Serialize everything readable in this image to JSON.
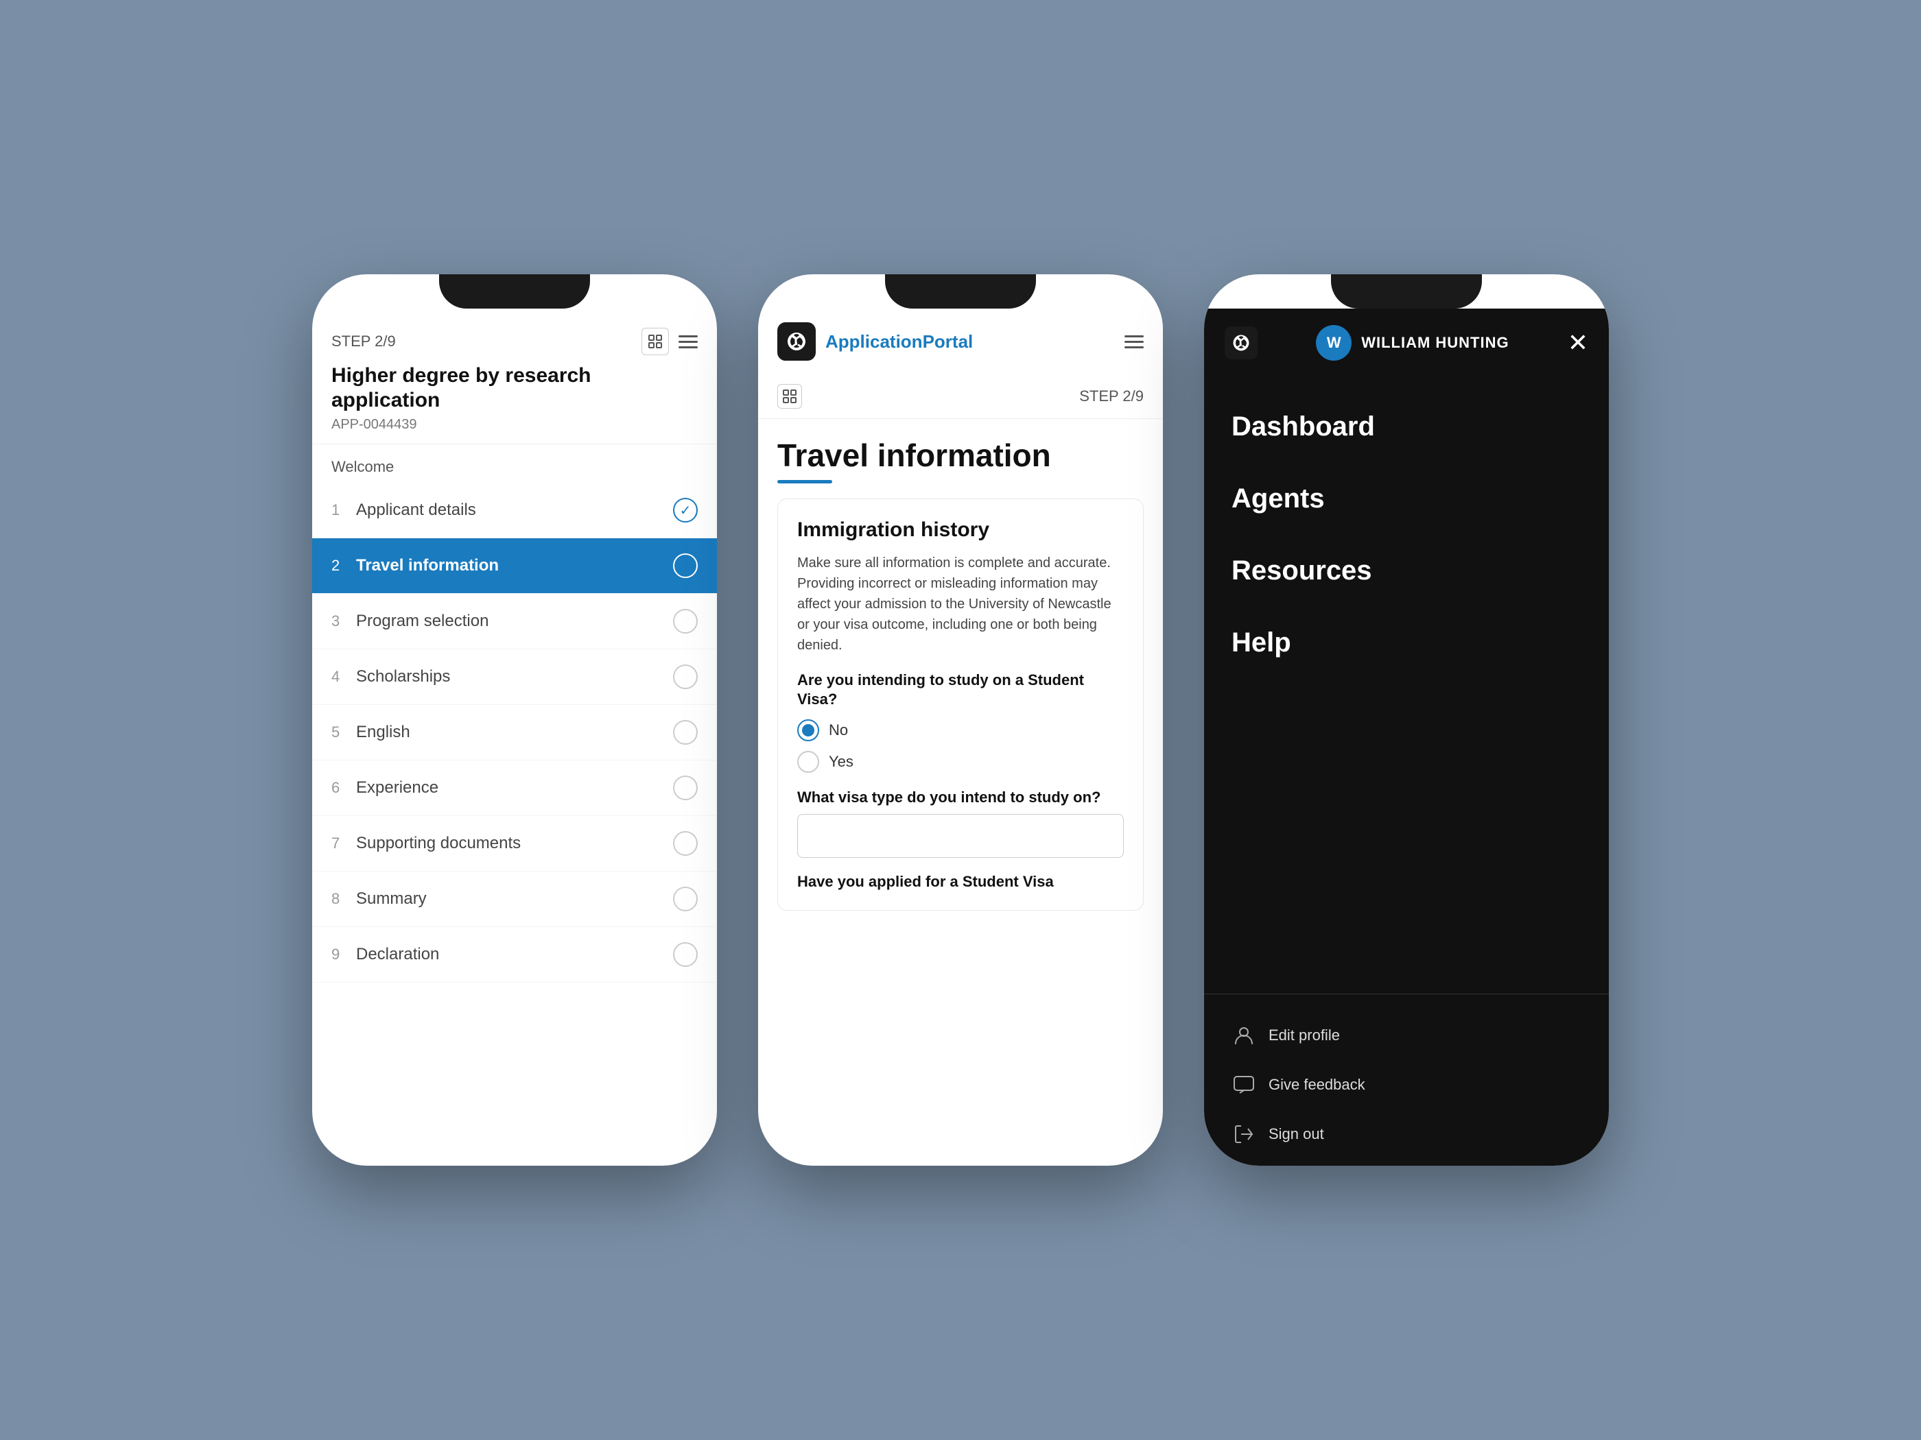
{
  "app": {
    "step_label": "STEP 2/9",
    "step_label_center": "STEP 2/9",
    "title": "Higher degree by research application",
    "app_id": "APP-0044439",
    "welcome": "Welcome",
    "portal_name": "Application",
    "portal_name_colored": "Portal"
  },
  "nav": {
    "items": [
      {
        "number": "1",
        "label": "Applicant details",
        "state": "checked"
      },
      {
        "number": "2",
        "label": "Travel information",
        "state": "active"
      },
      {
        "number": "3",
        "label": "Program selection",
        "state": "empty"
      },
      {
        "number": "4",
        "label": "Scholarships",
        "state": "empty"
      },
      {
        "number": "5",
        "label": "English",
        "state": "empty"
      },
      {
        "number": "6",
        "label": "Experience",
        "state": "empty"
      },
      {
        "number": "7",
        "label": "Supporting documents",
        "state": "empty"
      },
      {
        "number": "8",
        "label": "Summary",
        "state": "empty"
      },
      {
        "number": "9",
        "label": "Declaration",
        "state": "empty"
      }
    ]
  },
  "main": {
    "section_title": "Travel information",
    "card": {
      "title": "Immigration history",
      "body": "Make sure all information is complete and accurate. Providing incorrect or misleading information may affect your admission to the University of Newcastle or your visa outcome, including one or both being denied.",
      "q1": "Are you intending to study on a Student Visa?",
      "q1_options": [
        {
          "label": "No",
          "selected": true
        },
        {
          "label": "Yes",
          "selected": false
        }
      ],
      "q2": "What visa type do you intend to study on?",
      "q2_placeholder": "",
      "q3": "Have you applied for a Student Visa"
    }
  },
  "menu": {
    "user_name": "WILLIAM HUNTING",
    "user_initials": "W",
    "items": [
      {
        "label": "Dashboard"
      },
      {
        "label": "Agents"
      },
      {
        "label": "Resources"
      },
      {
        "label": "Help"
      }
    ],
    "footer": [
      {
        "label": "Edit profile",
        "icon": "profile-icon"
      },
      {
        "label": "Give feedback",
        "icon": "feedback-icon"
      },
      {
        "label": "Sign out",
        "icon": "signout-icon"
      }
    ]
  },
  "icons": {
    "expand": "⊞",
    "hamburger": "☰",
    "close": "✕",
    "check": "✓",
    "back_arrow": "←"
  },
  "colors": {
    "primary": "#1a7bbf",
    "dark": "#111111",
    "bg": "#7a8fa6"
  }
}
